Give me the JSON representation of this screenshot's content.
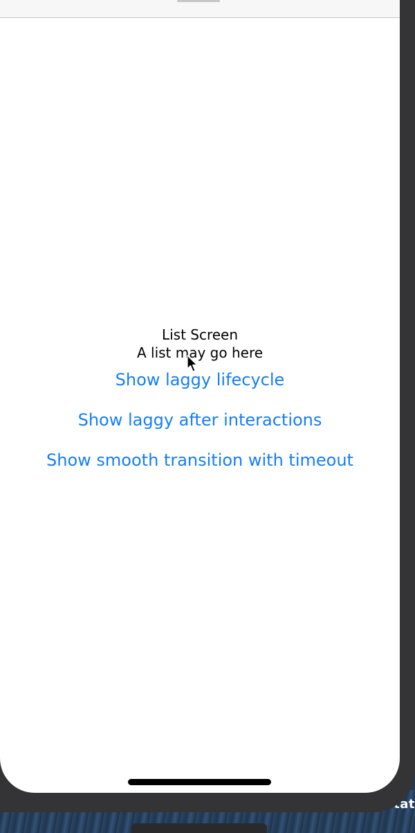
{
  "screen": {
    "title": "List Screen",
    "subtitle": "A list may go here"
  },
  "buttons": [
    {
      "label": "Show laggy lifecycle"
    },
    {
      "label": "Show laggy after interactions"
    },
    {
      "label": "Show smooth transition with timeout"
    }
  ],
  "desktop": {
    "label": "rotat"
  },
  "colors": {
    "link": "#147efb",
    "text": "#000000",
    "screen_bg": "#ffffff",
    "frame": "#343336"
  },
  "icons": {
    "cursor": "mouse-pointer-icon",
    "home_indicator": "home-indicator"
  }
}
